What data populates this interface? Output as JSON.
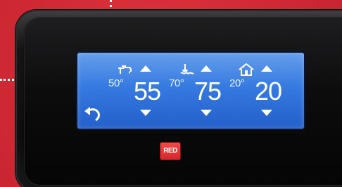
{
  "brand": {
    "logo_text": "RED",
    "accent": "#e2353f"
  },
  "display": {
    "back_icon": "back-arrow-icon",
    "zones": [
      {
        "icon": "tap-water-icon",
        "small_value": "50°",
        "big_value": "55"
      },
      {
        "icon": "radiator-heating-icon",
        "small_value": "70°",
        "big_value": "75"
      },
      {
        "icon": "house-heating-icon",
        "small_value": "20°",
        "big_value": "20"
      }
    ]
  }
}
